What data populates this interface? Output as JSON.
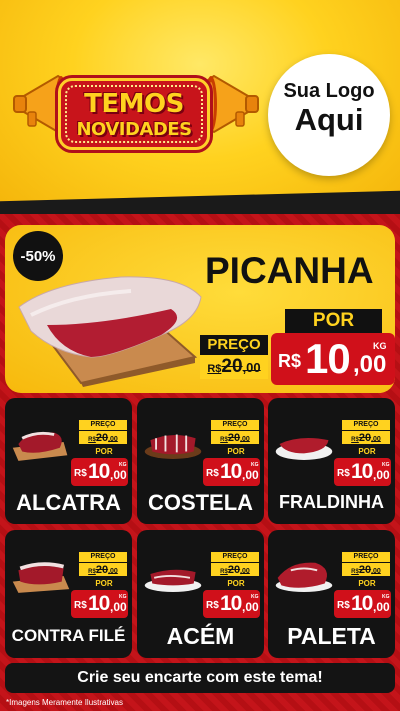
{
  "header": {
    "banner_line1": "TEMOS",
    "banner_line2": "NOVIDADES",
    "logo_line1": "Sua Logo",
    "logo_line2": "Aqui"
  },
  "featured": {
    "discount": "-50%",
    "name": "PICANHA",
    "old_label": "PREÇO",
    "old_currency": "R$",
    "old_int": "20",
    "old_cents": ",00",
    "por_label": "POR",
    "currency": "R$",
    "price_int": "10",
    "price_cents": ",00",
    "unit": "KG"
  },
  "products": [
    {
      "name": "ALCATRA",
      "old_label": "PREÇO",
      "old_currency": "R$",
      "old_int": "20",
      "old_cents": ",00",
      "por_label": "POR",
      "currency": "R$",
      "price_int": "10",
      "price_cents": ",00",
      "unit": "KG"
    },
    {
      "name": "COSTELA",
      "old_label": "PREÇO",
      "old_currency": "R$",
      "old_int": "20",
      "old_cents": ",00",
      "por_label": "POR",
      "currency": "R$",
      "price_int": "10",
      "price_cents": ",00",
      "unit": "KG"
    },
    {
      "name": "FRALDINHA",
      "old_label": "PREÇO",
      "old_currency": "R$",
      "old_int": "20",
      "old_cents": ",00",
      "por_label": "POR",
      "currency": "R$",
      "price_int": "10",
      "price_cents": ",00",
      "unit": "KG"
    },
    {
      "name": "CONTRA FILÉ",
      "old_label": "PREÇO",
      "old_currency": "R$",
      "old_int": "20",
      "old_cents": ",00",
      "por_label": "POR",
      "currency": "R$",
      "price_int": "10",
      "price_cents": ",00",
      "unit": "KG"
    },
    {
      "name": "ACÉM",
      "old_label": "PREÇO",
      "old_currency": "R$",
      "old_int": "20",
      "old_cents": ",00",
      "por_label": "POR",
      "currency": "R$",
      "price_int": "10",
      "price_cents": ",00",
      "unit": "KG"
    },
    {
      "name": "PALETA",
      "old_label": "PREÇO",
      "old_currency": "R$",
      "old_int": "20",
      "old_cents": ",00",
      "por_label": "POR",
      "currency": "R$",
      "price_int": "10",
      "price_cents": ",00",
      "unit": "KG"
    }
  ],
  "footer": {
    "cta": "Crie seu encarte com este tema!",
    "disclaimer": "*Imagens Meramente Ilustrativas"
  },
  "colors": {
    "yellow": "#ffd21f",
    "red": "#d0101a",
    "dark": "#131313"
  },
  "icons": [
    "megaphone-icon"
  ]
}
